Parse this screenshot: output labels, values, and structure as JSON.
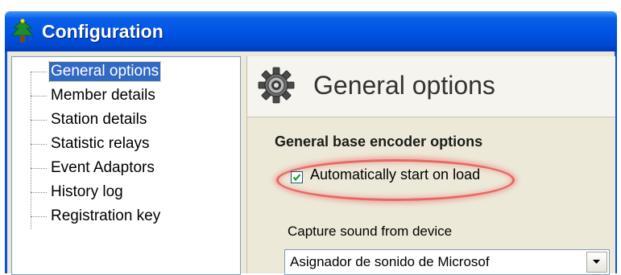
{
  "window": {
    "title": "Configuration",
    "title_icon": "tree-icon"
  },
  "sidebar": {
    "items": [
      {
        "label": "General options",
        "selected": true
      },
      {
        "label": "Member details",
        "selected": false
      },
      {
        "label": "Station details",
        "selected": false
      },
      {
        "label": "Statistic relays",
        "selected": false
      },
      {
        "label": "Event Adaptors",
        "selected": false
      },
      {
        "label": "History log",
        "selected": false
      },
      {
        "label": "Registration key",
        "selected": false
      }
    ]
  },
  "panel": {
    "icon": "gear-icon",
    "title": "General options",
    "section_title": "General base encoder options",
    "auto_start": {
      "label": "Automatically start on load",
      "checked": true
    },
    "capture_device": {
      "label": "Capture sound from device",
      "value": "Asignador de sonido de Microsof"
    }
  },
  "colors": {
    "titlebar": "#0055e5",
    "selection": "#316ac5",
    "highlight": "#e43c3c"
  }
}
